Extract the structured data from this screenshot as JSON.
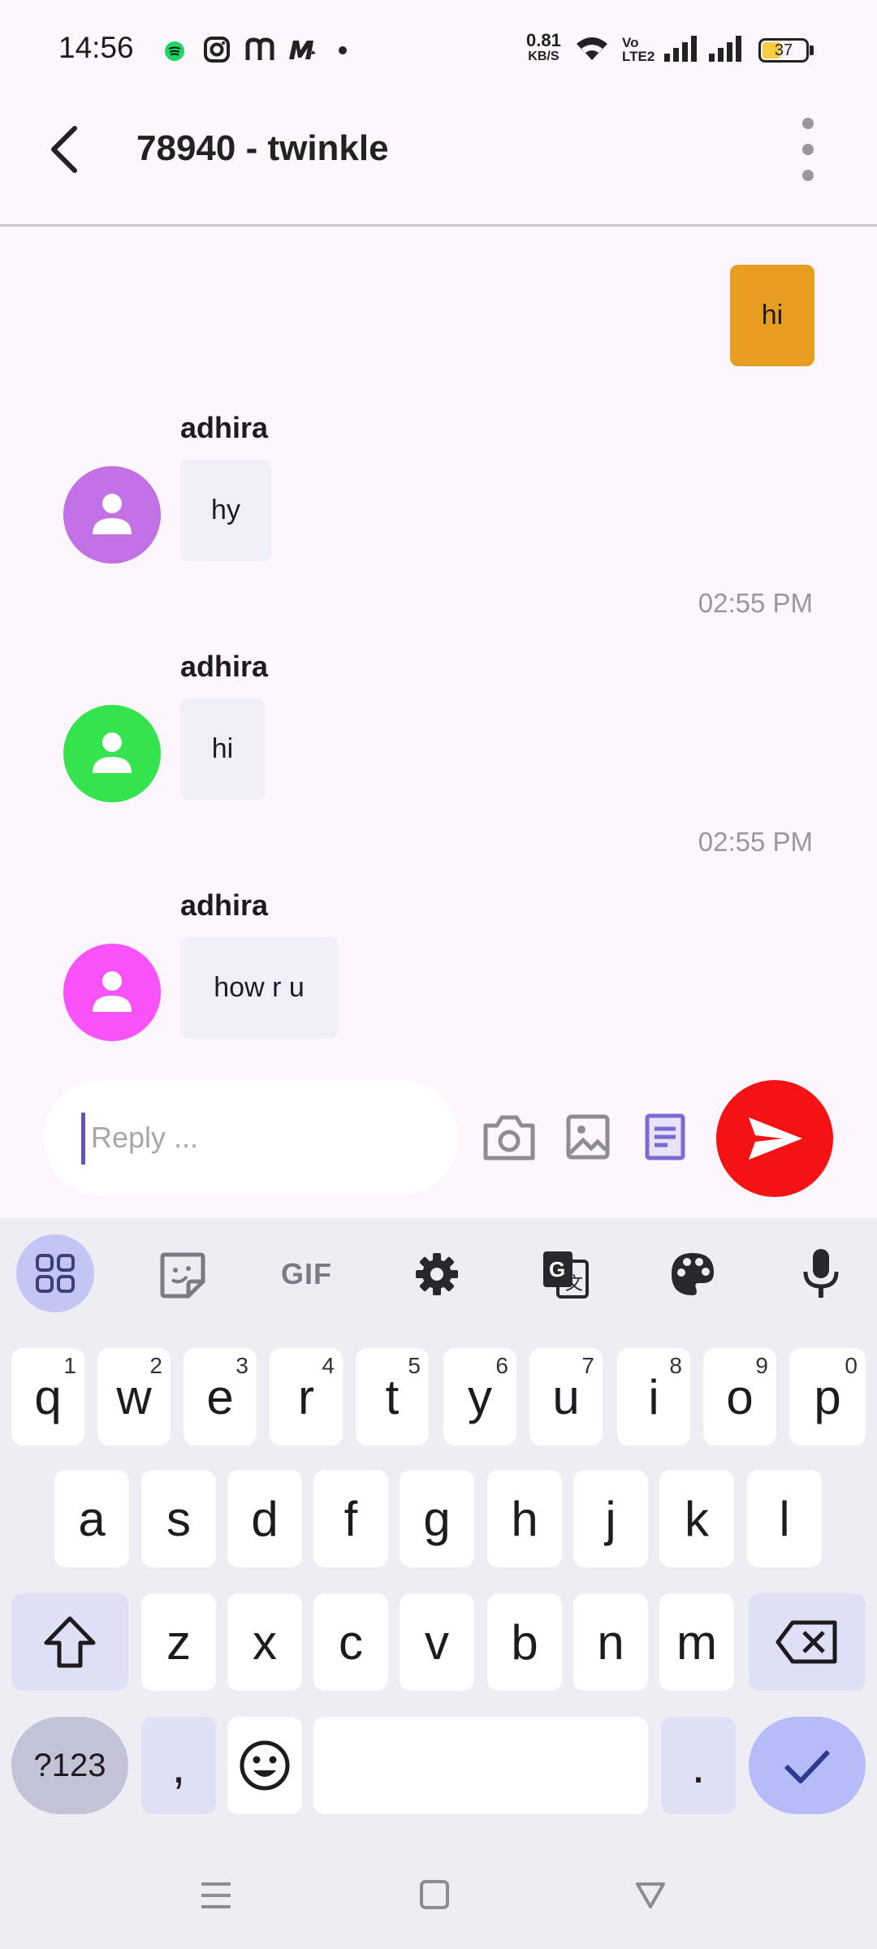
{
  "status_bar": {
    "time": "14:56",
    "net_speed": "0.81",
    "net_unit": "KB/S",
    "volte": "Vo\nLTE2",
    "battery": "37",
    "app_icons": [
      "spotify-icon",
      "instagram-icon",
      "m-app-icon",
      "mi-app-icon"
    ]
  },
  "header": {
    "title": "78940 - twinkle",
    "back_icon": "arrow-back-icon",
    "menu_icon": "more-vert-icon"
  },
  "messages": {
    "outgoing": {
      "text": "hi"
    },
    "incoming": [
      {
        "sender": "adhira",
        "text": "hy",
        "avatar_color": "#c170e6"
      },
      {
        "sender": "adhira",
        "text": "hi",
        "avatar_color": "#35e34e"
      },
      {
        "sender": "adhira",
        "text": "how r u",
        "avatar_color": "#fa52fb"
      }
    ],
    "times": [
      "02:55 PM",
      "02:55 PM"
    ]
  },
  "composer": {
    "placeholder": "Reply ...",
    "icons": [
      "camera-icon",
      "image-icon",
      "document-icon",
      "send-icon"
    ],
    "send_color": "#f51212"
  },
  "keyboard": {
    "toolbar": [
      "apps-grid-icon",
      "sticker-icon",
      "gif-icon",
      "settings-icon",
      "translate-icon",
      "palette-icon",
      "mic-icon"
    ],
    "gif_label": "GIF",
    "row1": [
      {
        "k": "q",
        "s": "1"
      },
      {
        "k": "w",
        "s": "2"
      },
      {
        "k": "e",
        "s": "3"
      },
      {
        "k": "r",
        "s": "4"
      },
      {
        "k": "t",
        "s": "5"
      },
      {
        "k": "y",
        "s": "6"
      },
      {
        "k": "u",
        "s": "7"
      },
      {
        "k": "i",
        "s": "8"
      },
      {
        "k": "o",
        "s": "9"
      },
      {
        "k": "p",
        "s": "0"
      }
    ],
    "row2": [
      "a",
      "s",
      "d",
      "f",
      "g",
      "h",
      "j",
      "k",
      "l"
    ],
    "row3": [
      "z",
      "x",
      "c",
      "v",
      "b",
      "n",
      "m"
    ],
    "sym_label": "?123",
    "comma": ",",
    "period": "."
  }
}
